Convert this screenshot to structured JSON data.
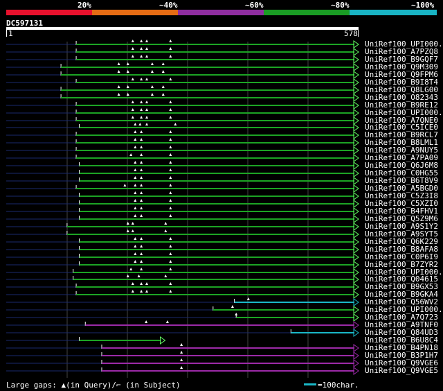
{
  "header": {
    "scale_labels": [
      "20%",
      "~40%",
      "~60%",
      "~80%",
      "~100%"
    ],
    "scale_colors": [
      "#e8112d",
      "#e56c14",
      "#8f2ea0",
      "#1a9c24",
      "#19b4c4"
    ],
    "query_id": "DC597131",
    "ruler_start": "1",
    "ruler_end": "578",
    "query_length": 578
  },
  "colors": {
    "green": "#1ca424",
    "green_arrow": "#66ff66",
    "cyan": "#1ab8c8",
    "purple": "#9c2aa8",
    "gap_line": "#1a2a6e",
    "grid": "#444444"
  },
  "hits": [
    {
      "label": "UniRef100_UPI000..",
      "start": 115,
      "end": 578,
      "color": "green",
      "marks": [
        208,
        222,
        231,
        270
      ]
    },
    {
      "label": "UniRef100_A7PZQ8",
      "start": 115,
      "end": 578,
      "color": "green",
      "marks": [
        208,
        222,
        231,
        270
      ]
    },
    {
      "label": "UniRef100_B9GQF7",
      "start": 115,
      "end": 578,
      "color": "green",
      "marks": [
        208,
        222,
        231,
        270
      ]
    },
    {
      "label": "UniRef100_Q9M309",
      "start": 90,
      "end": 578,
      "color": "green",
      "marks": [
        185,
        200,
        240,
        258
      ]
    },
    {
      "label": "UniRef100_Q9FPM6",
      "start": 90,
      "end": 578,
      "color": "green",
      "marks": [
        185,
        200,
        240,
        258
      ]
    },
    {
      "label": "UniRef100_B9I8T4",
      "start": 115,
      "end": 578,
      "color": "green",
      "marks": [
        208,
        222,
        231,
        270
      ]
    },
    {
      "label": "UniRef100_Q8LG00",
      "start": 90,
      "end": 578,
      "color": "green",
      "marks": [
        185,
        200,
        240,
        258
      ]
    },
    {
      "label": "UniRef100_O82343",
      "start": 90,
      "end": 578,
      "color": "green",
      "marks": [
        185,
        200,
        240,
        258
      ]
    },
    {
      "label": "UniRef100_B9RE12",
      "start": 115,
      "end": 578,
      "color": "green",
      "marks": [
        208,
        222,
        231,
        270
      ]
    },
    {
      "label": "UniRef100_UPI000..",
      "start": 115,
      "end": 578,
      "color": "green",
      "marks": [
        208,
        222,
        231,
        270
      ]
    },
    {
      "label": "UniRef100_A7QNE0",
      "start": 115,
      "end": 578,
      "color": "green",
      "marks": [
        208,
        222,
        231,
        270
      ]
    },
    {
      "label": "UniRef100_C5ICE0",
      "start": 120,
      "end": 578,
      "color": "green",
      "marks": [
        212,
        220,
        231,
        278
      ]
    },
    {
      "label": "UniRef100_B9RCL7",
      "start": 115,
      "end": 578,
      "color": "green",
      "marks": [
        212,
        222,
        270
      ]
    },
    {
      "label": "UniRef100_B8LML1",
      "start": 115,
      "end": 578,
      "color": "green",
      "marks": [
        212,
        222,
        270
      ]
    },
    {
      "label": "UniRef100_A9NUY5",
      "start": 115,
      "end": 578,
      "color": "green",
      "marks": [
        212,
        222,
        270
      ]
    },
    {
      "label": "UniRef100_A7PA09",
      "start": 115,
      "end": 578,
      "color": "green",
      "marks": [
        205,
        222,
        270
      ]
    },
    {
      "label": "UniRef100_Q6J6M8",
      "start": 120,
      "end": 578,
      "color": "green",
      "marks": [
        212,
        222,
        270
      ]
    },
    {
      "label": "UniRef100_C0HG55",
      "start": 120,
      "end": 578,
      "color": "green",
      "marks": [
        212,
        222,
        270
      ]
    },
    {
      "label": "UniRef100_B6T8V9",
      "start": 120,
      "end": 578,
      "color": "green",
      "marks": [
        212,
        222,
        270
      ]
    },
    {
      "label": "UniRef100_A5BGD0",
      "start": 115,
      "end": 578,
      "color": "green",
      "marks": [
        195,
        212,
        222,
        270
      ]
    },
    {
      "label": "UniRef100_C5Z3I8",
      "start": 120,
      "end": 578,
      "color": "green",
      "marks": [
        212,
        222,
        270
      ]
    },
    {
      "label": "UniRef100_C5XZI0",
      "start": 120,
      "end": 578,
      "color": "green",
      "marks": [
        212,
        222,
        270
      ]
    },
    {
      "label": "UniRef100_B4FHV1",
      "start": 120,
      "end": 578,
      "color": "green",
      "marks": [
        212,
        222,
        270
      ]
    },
    {
      "label": "UniRef100_Q5Z9M6",
      "start": 120,
      "end": 578,
      "color": "green",
      "marks": [
        212,
        222,
        270
      ]
    },
    {
      "label": "UniRef100_A9S1Y2",
      "start": 100,
      "end": 578,
      "color": "green",
      "marks": [
        200,
        208,
        262
      ]
    },
    {
      "label": "UniRef100_A9SYT5",
      "start": 100,
      "end": 578,
      "color": "green",
      "marks": [
        200,
        208,
        262
      ]
    },
    {
      "label": "UniRef100_Q6K229",
      "start": 120,
      "end": 578,
      "color": "green",
      "marks": [
        212,
        222,
        270
      ]
    },
    {
      "label": "UniRef100_B8AFA8",
      "start": 120,
      "end": 578,
      "color": "green",
      "marks": [
        212,
        222,
        270
      ]
    },
    {
      "label": "UniRef100_C0P6I9",
      "start": 120,
      "end": 578,
      "color": "green",
      "marks": [
        212,
        222,
        270
      ]
    },
    {
      "label": "UniRef100_B7ZYR2",
      "start": 120,
      "end": 578,
      "color": "green",
      "marks": [
        212,
        222,
        270
      ]
    },
    {
      "label": "UniRef100_UPI000..",
      "start": 110,
      "end": 578,
      "color": "green",
      "marks": [
        205,
        222,
        270
      ]
    },
    {
      "label": "UniRef100_Q04615",
      "start": 110,
      "end": 578,
      "color": "green",
      "marks": [
        200,
        218,
        262
      ]
    },
    {
      "label": "UniRef100_B9GX53",
      "start": 115,
      "end": 578,
      "color": "green",
      "marks": [
        208,
        222,
        231,
        270
      ]
    },
    {
      "label": "UniRef100_B9GKA4",
      "start": 115,
      "end": 578,
      "color": "green",
      "marks": [
        208,
        222,
        231,
        270
      ]
    },
    {
      "label": "UniRef100_Q56WV2",
      "start": 375,
      "end": 578,
      "color": "cyan",
      "marks": [
        398
      ]
    },
    {
      "label": "UniRef100_UPI000..",
      "start": 340,
      "end": 578,
      "color": "green",
      "marks": [
        372
      ]
    },
    {
      "label": "UniRef100_A7Q723",
      "start": 378,
      "end": 578,
      "color": "green",
      "marks": [
        378
      ],
      "dashed_start": 372
    },
    {
      "label": "UniRef100_A9TNF0",
      "start": 130,
      "end": 578,
      "color": "purple",
      "marks": [
        230,
        265
      ]
    },
    {
      "label": "UniRef100_Q84UD3",
      "start": 468,
      "end": 578,
      "color": "cyan",
      "marks": []
    },
    {
      "label": "UniRef100_B6U8C4",
      "start": 120,
      "end": 260,
      "color": "green",
      "marks": []
    },
    {
      "label": "UniRef100_B4PN18",
      "start": 157,
      "end": 578,
      "color": "purple",
      "marks": [
        288
      ]
    },
    {
      "label": "UniRef100_B3P1H7",
      "start": 157,
      "end": 578,
      "color": "purple",
      "marks": [
        288
      ]
    },
    {
      "label": "UniRef100_Q9VGE6",
      "start": 157,
      "end": 578,
      "color": "purple",
      "marks": [
        288
      ]
    },
    {
      "label": "UniRef100_Q9VGE5",
      "start": 157,
      "end": 578,
      "color": "purple",
      "marks": [
        288
      ]
    }
  ],
  "footer": {
    "legend_text": "Large gaps: ▲(in Query)/⌐ (in Subject)",
    "scale_text": "=100char."
  }
}
